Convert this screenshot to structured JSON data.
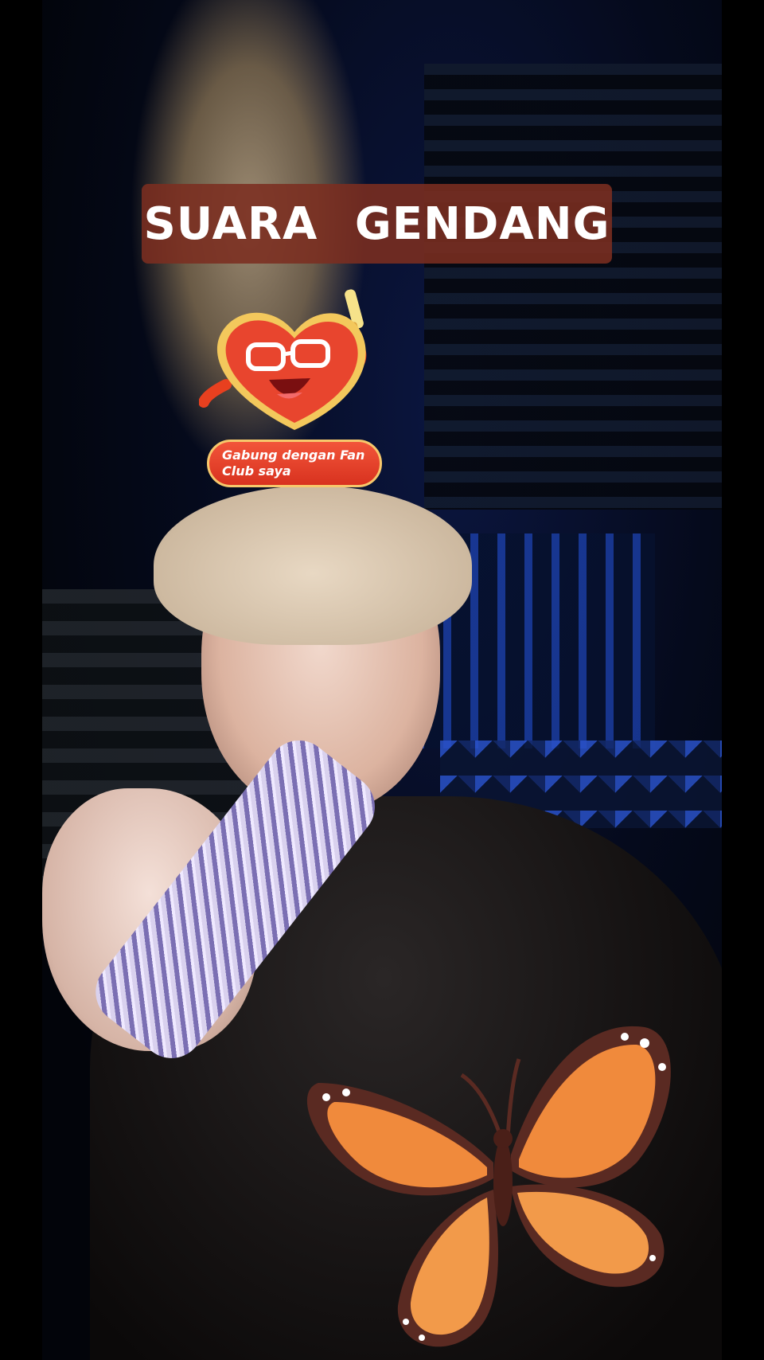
{
  "video": {
    "title_banner": "SUARA   GENDANG",
    "fan_club_label": "Gabung dengan Fan Club saya"
  },
  "stickers": {
    "heart_mascot_icon": "heart-mascot-icon",
    "butterfly_icon": "butterfly-icon"
  },
  "colors": {
    "banner_bg": "#7b2d20",
    "pill_red": "#e43f28",
    "pill_border": "#f7c86c",
    "butterfly_orange": "#f08a3c"
  }
}
